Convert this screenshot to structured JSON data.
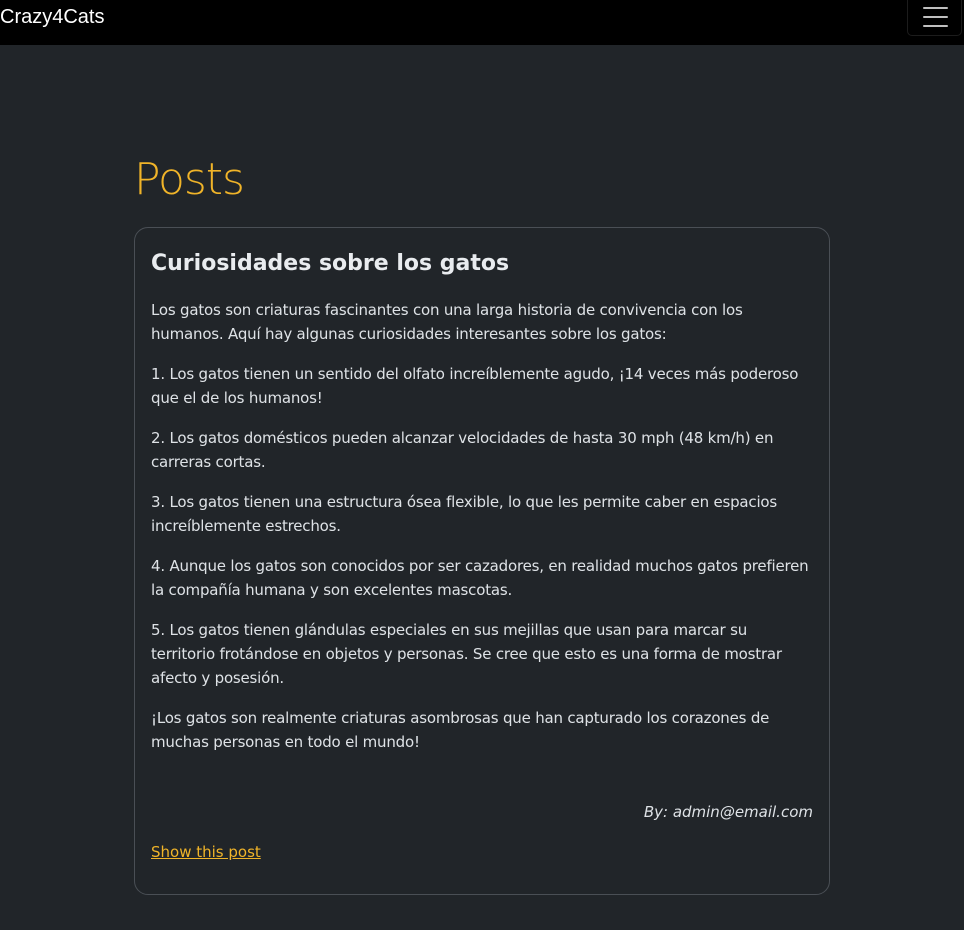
{
  "navbar": {
    "brand": "Crazy4Cats",
    "menu_icon": "hamburger-menu-icon"
  },
  "page": {
    "title": "Posts"
  },
  "post": {
    "title": "Curiosidades sobre los gatos",
    "paragraphs": [
      "Los gatos son criaturas fascinantes con una larga historia de convivencia con los humanos. Aquí hay algunas curiosidades interesantes sobre los gatos:",
      "1. Los gatos tienen un sentido del olfato increíblemente agudo, ¡14 veces más poderoso que el de los humanos!",
      "2. Los gatos domésticos pueden alcanzar velocidades de hasta 30 mph (48 km/h) en carreras cortas.",
      "3. Los gatos tienen una estructura ósea flexible, lo que les permite caber en espacios increíblemente estrechos.",
      "4. Aunque los gatos son conocidos por ser cazadores, en realidad muchos gatos prefieren la compañía humana y son excelentes mascotas.",
      "5. Los gatos tienen glándulas especiales en sus mejillas que usan para marcar su territorio frotándose en objetos y personas. Se cree que esto es una forma de mostrar afecto y posesión.",
      "¡Los gatos son realmente criaturas asombrosas que han capturado los corazones de muchas personas en todo el mundo!"
    ],
    "author": "By: admin@email.com",
    "show_link": "Show this post"
  },
  "colors": {
    "background": "#212529",
    "navbar": "#000000",
    "accent": "#f0b429",
    "card_border": "#4a4f55"
  }
}
